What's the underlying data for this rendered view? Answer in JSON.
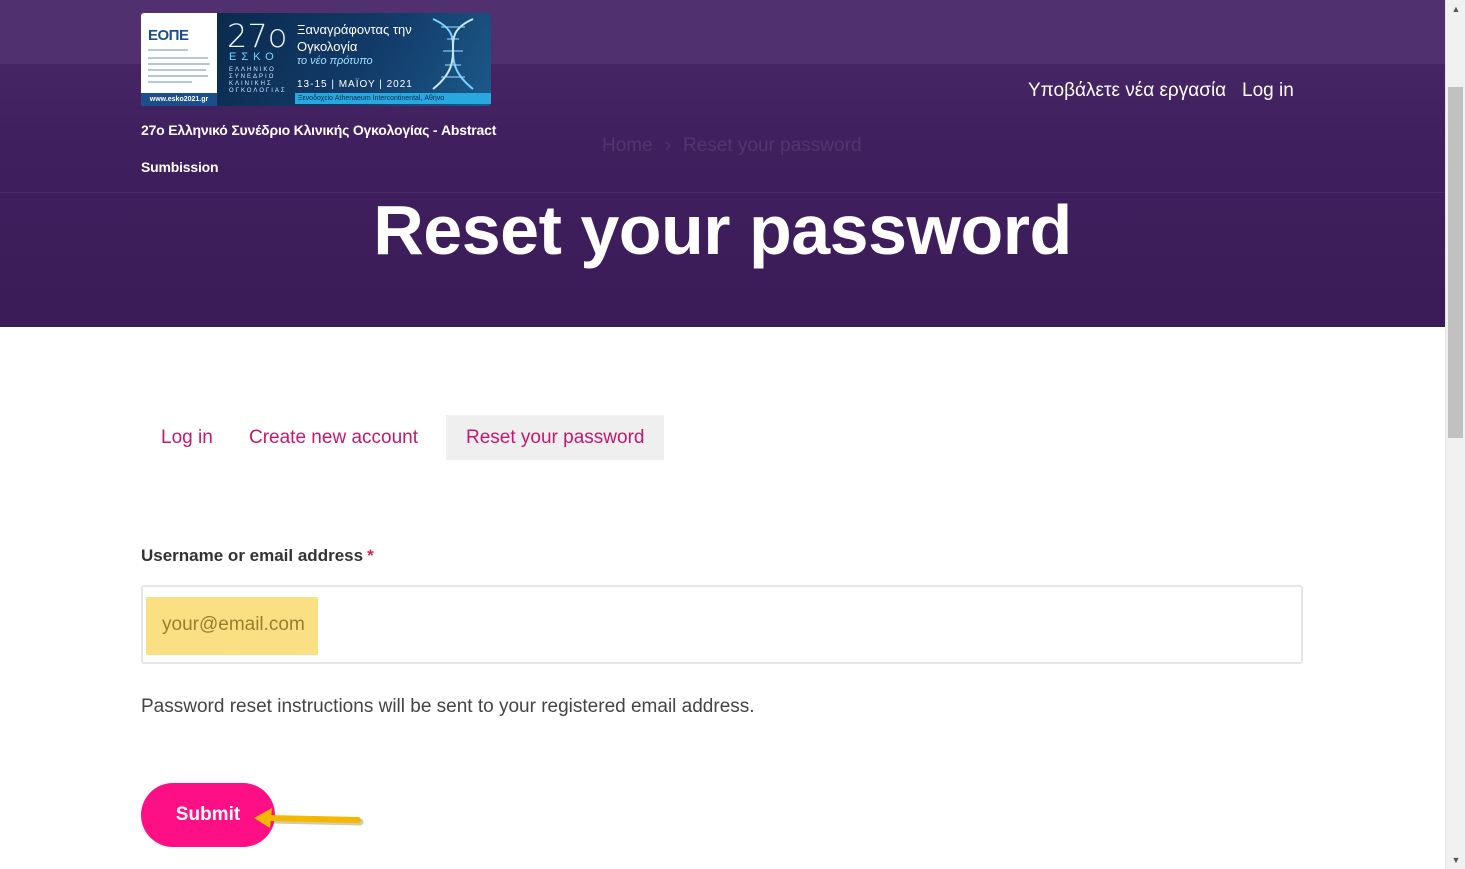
{
  "header": {
    "logo": {
      "org": "ΕΟΠΕ",
      "url": "www.esko2021.gr",
      "number": "27ο",
      "acronym": "ΕΣΚΟ",
      "subtitle": "ΕΛΛΗΝΙΚΟ ΣΥΝΕΔΡΙΟ ΚΛΙΝΙΚΗΣ ΟΓΚΟΛΟΓΙΑΣ",
      "tagline": "Ξαναγράφοντας την Ογκολογία",
      "tagline2": "το νέο πρότυπο",
      "dates": "13-15 | ΜΑΪΟΥ | 2021",
      "venue": "Ξενοδοχείο Athenaeum Intercontinental, Αθήνα"
    },
    "site_name": "27ο Ελληνικό Συνέδριο Κλινικής Ογκολογίας - Abstract Sumbission",
    "nav": {
      "submit_label": "Υποβάλετε νέα εργασία",
      "login_label": "Log in"
    },
    "breadcrumb": {
      "home": "Home",
      "separator": "›",
      "current": "Reset your password"
    },
    "page_title": "Reset your password"
  },
  "tabs": [
    {
      "label": "Log in",
      "active": false
    },
    {
      "label": "Create new account",
      "active": false
    },
    {
      "label": "Reset your password",
      "active": true
    }
  ],
  "form": {
    "field_label": "Username or email address",
    "required_mark": "*",
    "input_value": "",
    "input_placeholder": "your@email.com",
    "help_text": "Password reset instructions will be sent to your registered email address.",
    "submit_label": "Submit"
  },
  "colors": {
    "hero_bg": "#3f1f5e",
    "accent": "#c2196f",
    "button": "#ff0f86",
    "highlight": "#fbdf83",
    "arrow": "#f5b800"
  },
  "icons": {
    "annotation": "arrow-icon",
    "scroll_up": "scroll-up-icon",
    "scroll_down": "scroll-down-icon"
  }
}
